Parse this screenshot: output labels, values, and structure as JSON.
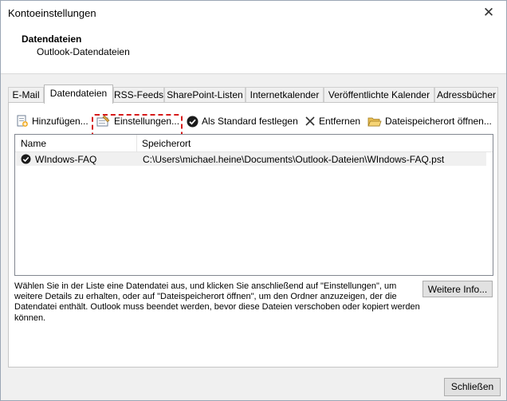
{
  "window": {
    "title": "Kontoeinstellungen",
    "close_symbol": "✕"
  },
  "header": {
    "title": "Datendateien",
    "subtitle": "Outlook-Datendateien"
  },
  "tabs": [
    {
      "label": "E-Mail"
    },
    {
      "label": "Datendateien",
      "active": true
    },
    {
      "label": "RSS-Feeds"
    },
    {
      "label": "SharePoint-Listen"
    },
    {
      "label": "Internetkalender"
    },
    {
      "label": "Veröffentlichte Kalender"
    },
    {
      "label": "Adressbücher"
    }
  ],
  "toolbar": {
    "add_label": "Hinzufügen...",
    "settings_label": "Einstellungen...",
    "default_label": "Als Standard festlegen",
    "remove_label": "Entfernen",
    "open_location_label": "Dateispeicherort öffnen..."
  },
  "list": {
    "columns": [
      "Name",
      "Speicherort"
    ],
    "rows": [
      {
        "name": "WIndows-FAQ",
        "location": "C:\\Users\\michael.heine\\Documents\\Outlook-Dateien\\WIndows-FAQ.pst",
        "is_default": true
      }
    ]
  },
  "hint_text": "Wählen Sie in der Liste eine Datendatei aus, und klicken Sie anschließend auf \"Einstellungen\", um weitere Details zu erhalten, oder auf \"Dateispeicherort öffnen\", um den Ordner anzuzeigen, der die Datendatei enthält. Outlook muss beendet werden, bevor diese Dateien verschoben oder kopiert werden können.",
  "buttons": {
    "more_info": "Weitere Info...",
    "close": "Schließen"
  },
  "colors": {
    "highlight_border": "#d61a1a",
    "selected_row": "#f0f0f0"
  }
}
